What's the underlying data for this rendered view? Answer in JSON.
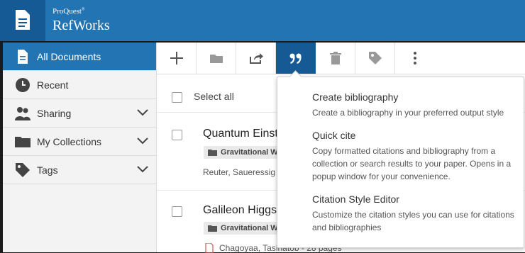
{
  "header": {
    "brand_small": "ProQuest",
    "brand_mark": "®",
    "brand_big": "RefWorks"
  },
  "sidebar": {
    "items": [
      {
        "label": "All Documents",
        "icon": "document-icon",
        "active": true
      },
      {
        "label": "Recent",
        "icon": "clock-icon"
      },
      {
        "label": "Sharing",
        "icon": "people-icon",
        "expandable": true
      },
      {
        "label": "My Collections",
        "icon": "folder-icon",
        "expandable": true
      },
      {
        "label": "Tags",
        "icon": "tag-icon",
        "expandable": true
      }
    ]
  },
  "toolbar": {
    "buttons": [
      "add-icon",
      "folder-icon",
      "share-icon",
      "quote-icon",
      "trash-icon",
      "tag-icon",
      "more-vertical-icon"
    ],
    "active": "quote-icon"
  },
  "list": {
    "select_all": "Select all",
    "documents": [
      {
        "title": "Quantum Einst",
        "collection": "Gravitational W.",
        "authors": "Reuter, Saueressig"
      },
      {
        "title": "Galileon Higgs",
        "collection": "Gravitational W.",
        "authors": "Chagoyaa, Tasinatob - 28 pages"
      }
    ]
  },
  "dropdown": {
    "items": [
      {
        "title": "Create bibliography",
        "desc": "Create a bibliography in your preferred output style"
      },
      {
        "title": "Quick cite",
        "desc": "Copy formatted citations and bibliography from a collection or search results to your paper. Opens in a popup window for your convenience."
      },
      {
        "title": "Citation Style Editor",
        "desc": "Customize the citation styles you can use for citations and bibliographies"
      }
    ]
  },
  "colors": {
    "header_blue": "#2374b3",
    "dark_blue": "#155a94",
    "sidebar_bg": "#f3f3f3"
  }
}
